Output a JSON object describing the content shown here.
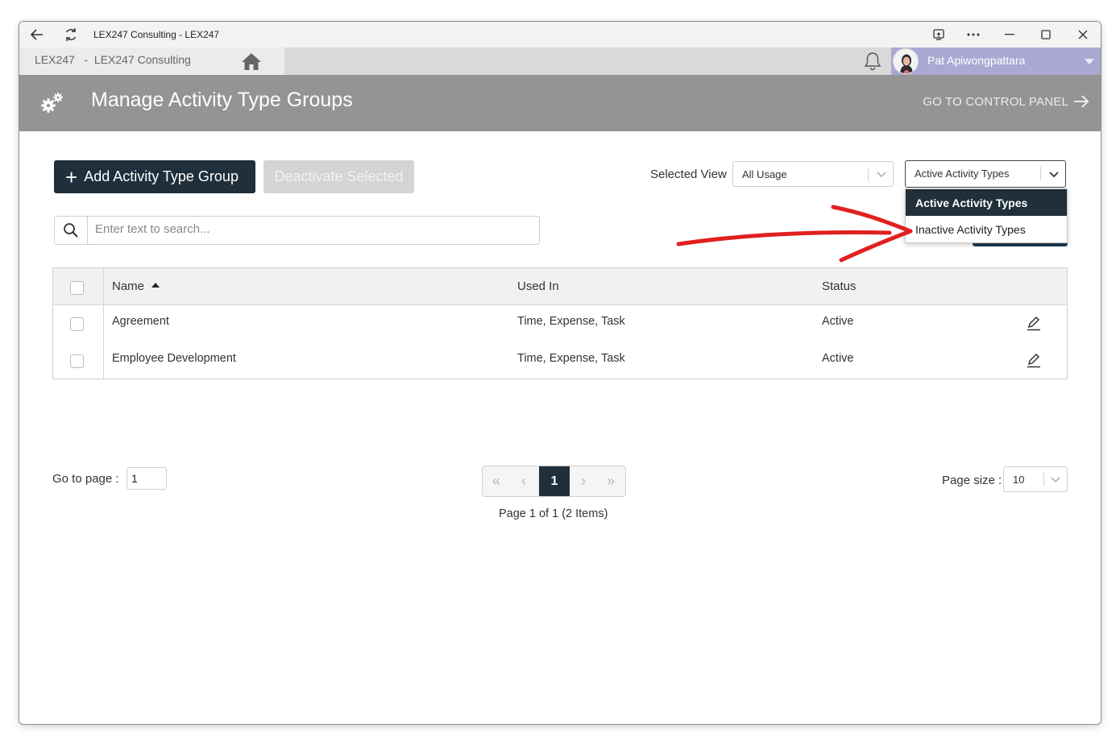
{
  "window": {
    "title": "LEX247 Consulting - LEX247"
  },
  "navbar": {
    "breadcrumb": "LEX247   -  LEX247 Consulting",
    "user_name": "Pat Apiwongpattara"
  },
  "header": {
    "title": "Manage Activity Type Groups",
    "control_panel_link": "GO TO CONTROL PANEL"
  },
  "toolbar": {
    "add_label": "Add Activity Type Group",
    "deactivate_label": "Deactivate Selected",
    "selected_view_label": "Selected View",
    "usage_select_value": "All Usage",
    "status_select_value": "Active Activity Types"
  },
  "status_dropdown": {
    "options": [
      {
        "label": "Active Activity Types",
        "selected": true
      },
      {
        "label": "Inactive Activity Types",
        "selected": false
      }
    ]
  },
  "search": {
    "placeholder": "Enter text to search..."
  },
  "table": {
    "columns": [
      "Name",
      "Used In",
      "Status"
    ],
    "sort": {
      "column": "Name",
      "direction": "ascending"
    },
    "rows": [
      {
        "name": "Agreement",
        "used_in": "Time, Expense, Task",
        "status": "Active"
      },
      {
        "name": "Employee Development",
        "used_in": "Time, Expense, Task",
        "status": "Active"
      }
    ]
  },
  "pagination": {
    "goto_label": "Go to page :",
    "goto_value": "1",
    "current_page": "1",
    "info": "Page 1 of 1 (2 Items)",
    "page_size_label": "Page size :",
    "page_size_value": "10"
  },
  "colors": {
    "header_bg": "#949494",
    "primary_dark": "#1f2f3b",
    "user_box": "#a9a9d3",
    "annotation_arrow": "#e02020"
  }
}
